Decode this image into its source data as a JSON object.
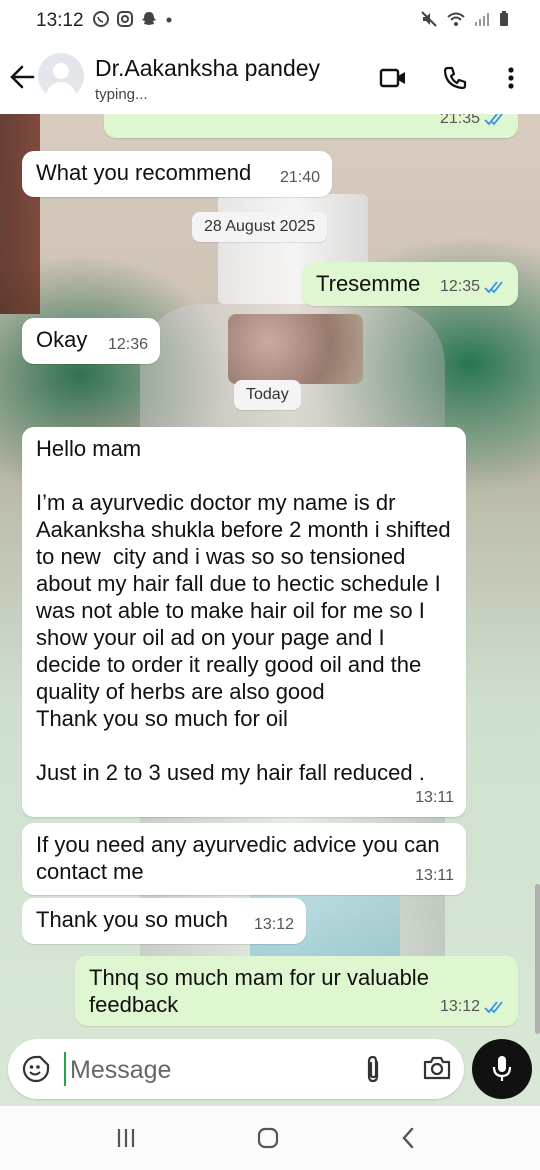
{
  "status_bar": {
    "time": "13:12"
  },
  "header": {
    "contact_name": "Dr.Aakanksha pandey",
    "contact_status": "typing..."
  },
  "messages": [
    {
      "direction": "out",
      "text": "",
      "time": "21:35",
      "read": true
    },
    {
      "direction": "in",
      "text": "What you recommend",
      "time": "21:40"
    },
    {
      "type": "date",
      "text": "28 August 2025"
    },
    {
      "direction": "out",
      "text": "Tresemme",
      "time": "12:35",
      "read": true
    },
    {
      "direction": "in",
      "text": "Okay",
      "time": "12:36"
    },
    {
      "type": "date",
      "text": "Today"
    },
    {
      "direction": "in",
      "text": "Hello mam\n\nI’m a ayurvedic doctor my name is dr Aakanksha shukla before 2 month i shifted  to new  city and i was so so tensioned about my hair fall due to hectic schedule I was not able to make hair oil for me so I show your oil ad on your page and I decide to order it really good oil and the quality of herbs are also good\nThank you so much for oil\n\nJust in 2 to 3 used my hair fall reduced .",
      "time": "13:11"
    },
    {
      "direction": "in",
      "text": "If you need any ayurvedic advice you can contact me",
      "time": "13:11"
    },
    {
      "direction": "in",
      "text": "Thank you so much",
      "time": "13:12"
    },
    {
      "direction": "out",
      "text": "Thnq so much mam for ur valuable feedback",
      "time": "13:12",
      "read": true
    }
  ],
  "composer": {
    "placeholder": "Message"
  },
  "colors": {
    "outgoing_bubble": "#dff7d0",
    "incoming_bubble": "#ffffff",
    "read_tick": "#3b8fe8",
    "mic_button": "#111111"
  },
  "icons": [
    "back-arrow-icon",
    "video-call-icon",
    "phone-icon",
    "more-options-icon",
    "emoji-icon",
    "attach-icon",
    "camera-icon",
    "mic-icon"
  ]
}
